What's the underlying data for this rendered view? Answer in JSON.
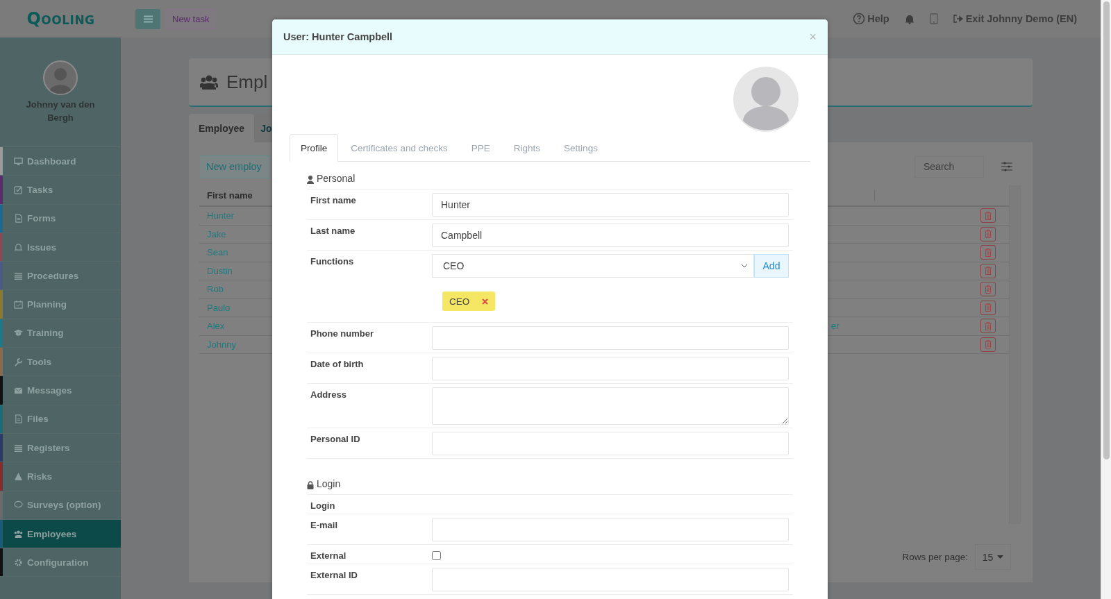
{
  "topbar": {
    "logo": "QOOLING",
    "new_task": "New task",
    "help": "Help",
    "exit": "Exit Johnny Demo (EN)"
  },
  "sidebar": {
    "user_name": "Johnny van den Bergh",
    "items": [
      {
        "label": "Dashboard",
        "color": "#9a9a9a",
        "selected": false
      },
      {
        "label": "Tasks",
        "color": "#5c2a6e",
        "selected": false
      },
      {
        "label": "Forms",
        "color": "#1a6a94",
        "selected": false
      },
      {
        "label": "Issues",
        "color": "#8a4a55",
        "selected": false
      },
      {
        "label": "Procedures",
        "color": "#4a5a88",
        "selected": false
      },
      {
        "label": "Planning",
        "color": "#8a7a2a",
        "selected": false
      },
      {
        "label": "Training",
        "color": "#1a7a8a",
        "selected": false
      },
      {
        "label": "Tools",
        "color": "#8a6a4a",
        "selected": false
      },
      {
        "label": "Messages",
        "color": "#111111",
        "selected": false
      },
      {
        "label": "Files",
        "color": "#1a6a7a",
        "selected": false
      },
      {
        "label": "Registers",
        "color": "#2a3a6a",
        "selected": false
      },
      {
        "label": "Risks",
        "color": "#8a2a2a",
        "selected": false
      },
      {
        "label": "Surveys (option)",
        "color": "#6a6a6a",
        "selected": false
      },
      {
        "label": "Employees",
        "color": "#1a5a7a",
        "selected": true
      },
      {
        "label": "Configuration",
        "color": "#111111",
        "selected": false
      }
    ]
  },
  "page": {
    "title": "Empl",
    "tabs": [
      {
        "label": "Employee",
        "selected": true
      },
      {
        "label": "Jo",
        "selected": false
      }
    ],
    "new_button": "New employ",
    "search": {
      "placeholder": "Search"
    },
    "table": {
      "columns": [
        "First name"
      ],
      "rows": [
        {
          "first_name": "Hunter"
        },
        {
          "first_name": "Jake"
        },
        {
          "first_name": "Sean"
        },
        {
          "first_name": "Dustin"
        },
        {
          "first_name": "Rob"
        },
        {
          "first_name": "Paulo"
        },
        {
          "first_name": "Alex",
          "column_3": "er"
        },
        {
          "first_name": "Johnny"
        }
      ]
    },
    "rows_per_page": {
      "label": "Rows per page:",
      "value": "15"
    }
  },
  "modal": {
    "title": "User: Hunter Campbell",
    "close": "×",
    "tabs": [
      {
        "label": "Profile",
        "selected": true
      },
      {
        "label": "Certificates and checks",
        "selected": false
      },
      {
        "label": "PPE",
        "selected": false
      },
      {
        "label": "Rights",
        "selected": false
      },
      {
        "label": "Settings",
        "selected": false
      }
    ],
    "sections": [
      {
        "title": "Personal",
        "fields": [
          {
            "label": "First name",
            "kind": "input",
            "value": "Hunter"
          },
          {
            "label": "Last name",
            "kind": "input",
            "value": "Campbell"
          },
          {
            "label": "Functions",
            "kind": "select",
            "value": "CEO",
            "button": "Add",
            "tags": [
              "CEO"
            ]
          },
          {
            "label": "Phone number",
            "kind": "input"
          },
          {
            "label": "Date of birth",
            "kind": "input"
          },
          {
            "label": "Address",
            "kind": "textarea"
          },
          {
            "label": "Personal ID",
            "kind": "input"
          }
        ]
      },
      {
        "title": "Login",
        "fields": [
          {
            "label": "Login",
            "kind": "heading"
          },
          {
            "label": "E-mail",
            "kind": "input"
          },
          {
            "label": "External",
            "kind": "checkbox",
            "checked": false
          },
          {
            "label": "External ID",
            "kind": "input"
          }
        ]
      }
    ]
  }
}
